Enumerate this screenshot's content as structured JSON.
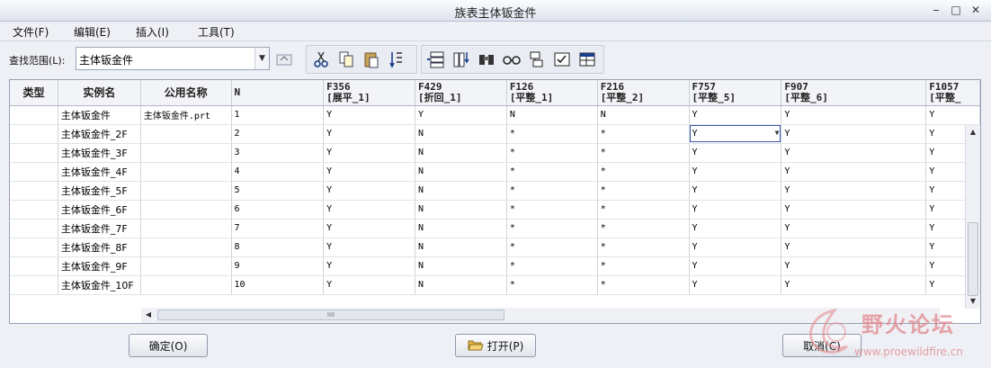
{
  "window": {
    "title": "族表主体钣金件"
  },
  "menu": [
    "文件(F)",
    "编辑(E)",
    "插入(I)",
    "工具(T)"
  ],
  "toolbar": {
    "scope_label": "查找范围(L):",
    "scope_value": "主体钣金件",
    "icons": [
      "navigate-up-icon",
      "cut-icon",
      "copy-icon",
      "paste-icon",
      "fill-down-icon",
      "insert-row-icon",
      "insert-column-icon",
      "find-icon",
      "preview-icon",
      "select-item-icon",
      "verify-icon",
      "table-properties-icon"
    ]
  },
  "table": {
    "headers": {
      "type": "类型",
      "instance": "实例名",
      "common": "公用名称",
      "n": "N",
      "f356_code": "F356",
      "f356_name": "[展平_1]",
      "f429_code": "F429",
      "f429_name": "[折回_1]",
      "f126_code": "F126",
      "f126_name": "[平整_1]",
      "f216_code": "F216",
      "f216_name": "[平整_2]",
      "f757_code": "F757",
      "f757_name": "[平整_5]",
      "f907_code": "F907",
      "f907_name": "[平整_6]",
      "f1057_code": "F1057",
      "f1057_name": "[平整_"
    },
    "rows": [
      {
        "type": "",
        "instance": "主体钣金件",
        "common": "主体钣金件.prt",
        "n": "1",
        "f356": "Y",
        "f429": "Y",
        "f126": "N",
        "f216": "N",
        "f757": "Y",
        "f907": "Y",
        "f1057": "Y"
      },
      {
        "type": "",
        "instance": "主体钣金件_2F",
        "common": "",
        "n": "2",
        "f356": "Y",
        "f429": "N",
        "f126": "*",
        "f216": "*",
        "f757": "Y",
        "f907": "Y",
        "f1057": "Y"
      },
      {
        "type": "",
        "instance": "主体钣金件_3F",
        "common": "",
        "n": "3",
        "f356": "Y",
        "f429": "N",
        "f126": "*",
        "f216": "*",
        "f757": "Y",
        "f907": "Y",
        "f1057": "Y"
      },
      {
        "type": "",
        "instance": "主体钣金件_4F",
        "common": "",
        "n": "4",
        "f356": "Y",
        "f429": "N",
        "f126": "*",
        "f216": "*",
        "f757": "Y",
        "f907": "Y",
        "f1057": "Y"
      },
      {
        "type": "",
        "instance": "主体钣金件_5F",
        "common": "",
        "n": "5",
        "f356": "Y",
        "f429": "N",
        "f126": "*",
        "f216": "*",
        "f757": "Y",
        "f907": "Y",
        "f1057": "Y"
      },
      {
        "type": "",
        "instance": "主体钣金件_6F",
        "common": "",
        "n": "6",
        "f356": "Y",
        "f429": "N",
        "f126": "*",
        "f216": "*",
        "f757": "Y",
        "f907": "Y",
        "f1057": "Y"
      },
      {
        "type": "",
        "instance": "主体钣金件_7F",
        "common": "",
        "n": "7",
        "f356": "Y",
        "f429": "N",
        "f126": "*",
        "f216": "*",
        "f757": "Y",
        "f907": "Y",
        "f1057": "Y"
      },
      {
        "type": "",
        "instance": "主体钣金件_8F",
        "common": "",
        "n": "8",
        "f356": "Y",
        "f429": "N",
        "f126": "*",
        "f216": "*",
        "f757": "Y",
        "f907": "Y",
        "f1057": "Y"
      },
      {
        "type": "",
        "instance": "主体钣金件_9F",
        "common": "",
        "n": "9",
        "f356": "Y",
        "f429": "N",
        "f126": "*",
        "f216": "*",
        "f757": "Y",
        "f907": "Y",
        "f1057": "Y"
      },
      {
        "type": "",
        "instance": "主体钣金件_10F",
        "common": "",
        "n": "10",
        "f356": "Y",
        "f429": "N",
        "f126": "*",
        "f216": "*",
        "f757": "Y",
        "f907": "Y",
        "f1057": "Y"
      }
    ],
    "scroll_grip": "IIII"
  },
  "buttons": {
    "ok": "确定(O)",
    "open": "打开(P)",
    "cancel": "取消(C)"
  },
  "watermark": {
    "text": "野火论坛",
    "url": "www.proewildfire.cn"
  }
}
